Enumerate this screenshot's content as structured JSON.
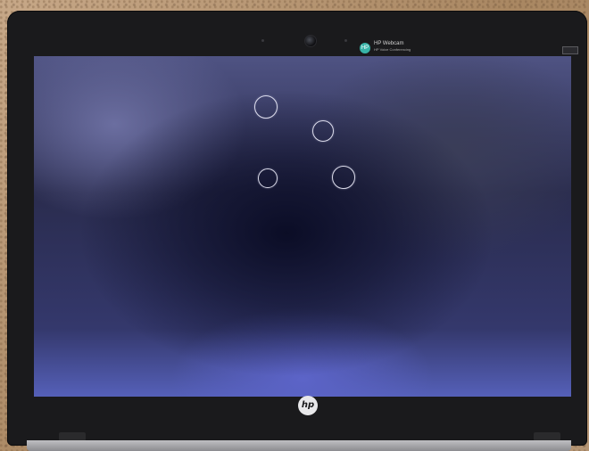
{
  "webcam_notice": {
    "badge_glyph": "HP",
    "title": "HP Webcam",
    "subtitle": "HP Voice Conferencing"
  },
  "logo": {
    "text": "hp"
  },
  "screen": {
    "state": "blank desktop with loading dots",
    "rings": [
      "loading-ring-1",
      "loading-ring-2",
      "loading-ring-3",
      "loading-ring-4"
    ]
  },
  "colors": {
    "bezel": "#1a1a1c",
    "screen_dark": "#0b0d26",
    "screen_light": "#5560b8",
    "ring": "#ececf8",
    "badge": "#38b4a8"
  }
}
